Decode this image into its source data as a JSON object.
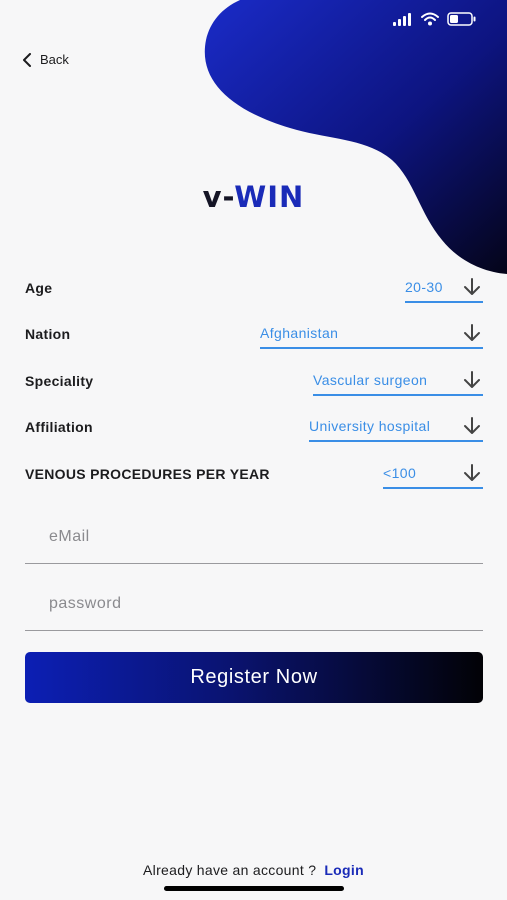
{
  "nav": {
    "back_label": "Back"
  },
  "brand": {
    "part1": "v-",
    "part2": "WIN"
  },
  "form": {
    "rows": [
      {
        "label": "Age",
        "value": "20-30"
      },
      {
        "label": "Nation",
        "value": "Afghanistan"
      },
      {
        "label": "Speciality",
        "value": "Vascular surgeon"
      },
      {
        "label": "Affiliation",
        "value": "University hospital"
      },
      {
        "label": "VENOUS PROCEDURES PER YEAR",
        "value": "<100"
      }
    ],
    "email_placeholder": "eMail",
    "password_placeholder": "password"
  },
  "register_label": "Register Now",
  "footer": {
    "text": "Already have an account ?",
    "login_label": "Login"
  },
  "colors": {
    "accent": "#3a8ee6",
    "brand": "#1a2bb8",
    "gradient_start": "#0c1fb4",
    "gradient_end": "#020206"
  },
  "icons": {
    "status": [
      "cellular-signal-icon",
      "wifi-icon",
      "battery-icon"
    ],
    "back": "chevron-left-icon",
    "dropdown": "arrow-down-icon"
  }
}
